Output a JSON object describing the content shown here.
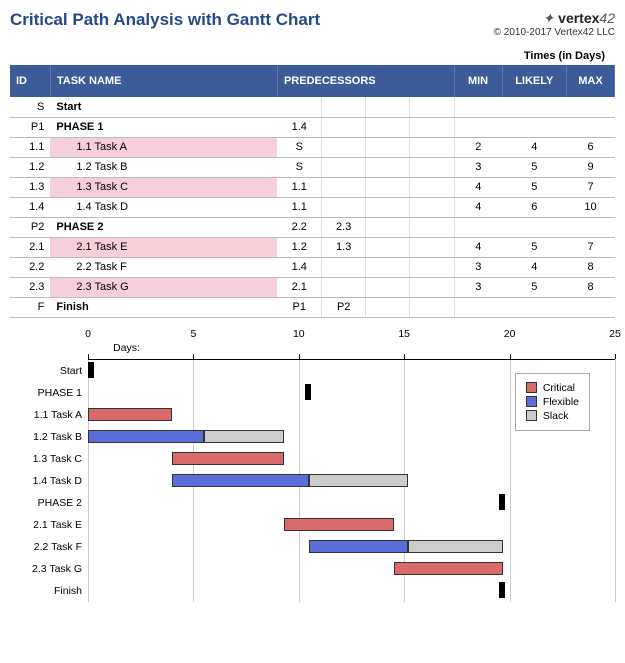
{
  "title": "Critical Path Analysis with Gantt Chart",
  "brand": {
    "name_html": "vertex42",
    "copyright": "© 2010-2017 Vertex42 LLC"
  },
  "times_label": "Times (in Days)",
  "columns": {
    "id": "ID",
    "task": "TASK NAME",
    "pred": "PREDECESSORS",
    "min": "MIN",
    "likely": "LIKELY",
    "max": "MAX"
  },
  "rows": [
    {
      "id": "S",
      "name": "Start",
      "bold": true,
      "critical": false,
      "pred": [],
      "min": "",
      "likely": "",
      "max": ""
    },
    {
      "id": "P1",
      "name": "PHASE 1",
      "bold": true,
      "critical": false,
      "pred": [
        "1.4"
      ],
      "min": "",
      "likely": "",
      "max": ""
    },
    {
      "id": "1.1",
      "name": "1.1 Task A",
      "bold": false,
      "critical": true,
      "pred": [
        "S"
      ],
      "min": "2",
      "likely": "4",
      "max": "6",
      "indent": true
    },
    {
      "id": "1.2",
      "name": "1.2 Task B",
      "bold": false,
      "critical": false,
      "pred": [
        "S"
      ],
      "min": "3",
      "likely": "5",
      "max": "9",
      "indent": true
    },
    {
      "id": "1.3",
      "name": "1.3 Task C",
      "bold": false,
      "critical": true,
      "pred": [
        "1.1"
      ],
      "min": "4",
      "likely": "5",
      "max": "7",
      "indent": true
    },
    {
      "id": "1.4",
      "name": "1.4 Task D",
      "bold": false,
      "critical": false,
      "pred": [
        "1.1"
      ],
      "min": "4",
      "likely": "6",
      "max": "10",
      "indent": true
    },
    {
      "id": "P2",
      "name": "PHASE 2",
      "bold": true,
      "critical": false,
      "pred": [
        "2.2",
        "2.3"
      ],
      "min": "",
      "likely": "",
      "max": ""
    },
    {
      "id": "2.1",
      "name": "2.1 Task E",
      "bold": false,
      "critical": true,
      "pred": [
        "1.2",
        "1.3"
      ],
      "min": "4",
      "likely": "5",
      "max": "7",
      "indent": true
    },
    {
      "id": "2.2",
      "name": "2.2 Task F",
      "bold": false,
      "critical": false,
      "pred": [
        "1.4"
      ],
      "min": "3",
      "likely": "4",
      "max": "8",
      "indent": true
    },
    {
      "id": "2.3",
      "name": "2.3 Task G",
      "bold": false,
      "critical": true,
      "pred": [
        "2.1"
      ],
      "min": "3",
      "likely": "5",
      "max": "8",
      "indent": true
    },
    {
      "id": "F",
      "name": "Finish",
      "bold": true,
      "critical": false,
      "pred": [
        "P1",
        "P2"
      ],
      "min": "",
      "likely": "",
      "max": ""
    }
  ],
  "legend": {
    "critical": "Critical",
    "flexible": "Flexible",
    "slack": "Slack"
  },
  "chart_data": {
    "type": "bar",
    "orientation": "horizontal",
    "xlabel": "Days:",
    "xlim": [
      0,
      25
    ],
    "xticks": [
      0,
      5,
      10,
      15,
      20,
      25
    ],
    "categories": [
      "Start",
      "PHASE 1",
      "1.1 Task A",
      "1.2 Task B",
      "1.3 Task C",
      "1.4 Task D",
      "PHASE 2",
      "2.1 Task E",
      "2.2 Task F",
      "2.3 Task G",
      "Finish"
    ],
    "series": [
      {
        "name": "Critical",
        "color": "#da6a6a",
        "bars": [
          {
            "row": 2,
            "start": 0,
            "end": 4
          },
          {
            "row": 4,
            "start": 4,
            "end": 9.3
          },
          {
            "row": 7,
            "start": 9.3,
            "end": 14.5
          },
          {
            "row": 9,
            "start": 14.5,
            "end": 19.7
          }
        ]
      },
      {
        "name": "Flexible",
        "color": "#5a6dd8",
        "bars": [
          {
            "row": 3,
            "start": 0,
            "end": 5.5
          },
          {
            "row": 5,
            "start": 4,
            "end": 10.5
          },
          {
            "row": 8,
            "start": 10.5,
            "end": 15.2
          }
        ]
      },
      {
        "name": "Slack",
        "color": "#cccccc",
        "bars": [
          {
            "row": 3,
            "start": 5.5,
            "end": 9.3
          },
          {
            "row": 5,
            "start": 10.5,
            "end": 15.2
          },
          {
            "row": 8,
            "start": 15.2,
            "end": 19.7
          }
        ]
      },
      {
        "name": "Milestone",
        "color": "#000000",
        "bars": [
          {
            "row": 0,
            "start": 0,
            "end": 0.3
          },
          {
            "row": 1,
            "start": 10.3,
            "end": 10.6
          },
          {
            "row": 6,
            "start": 19.5,
            "end": 19.8
          },
          {
            "row": 10,
            "start": 19.5,
            "end": 19.8
          }
        ]
      }
    ]
  }
}
